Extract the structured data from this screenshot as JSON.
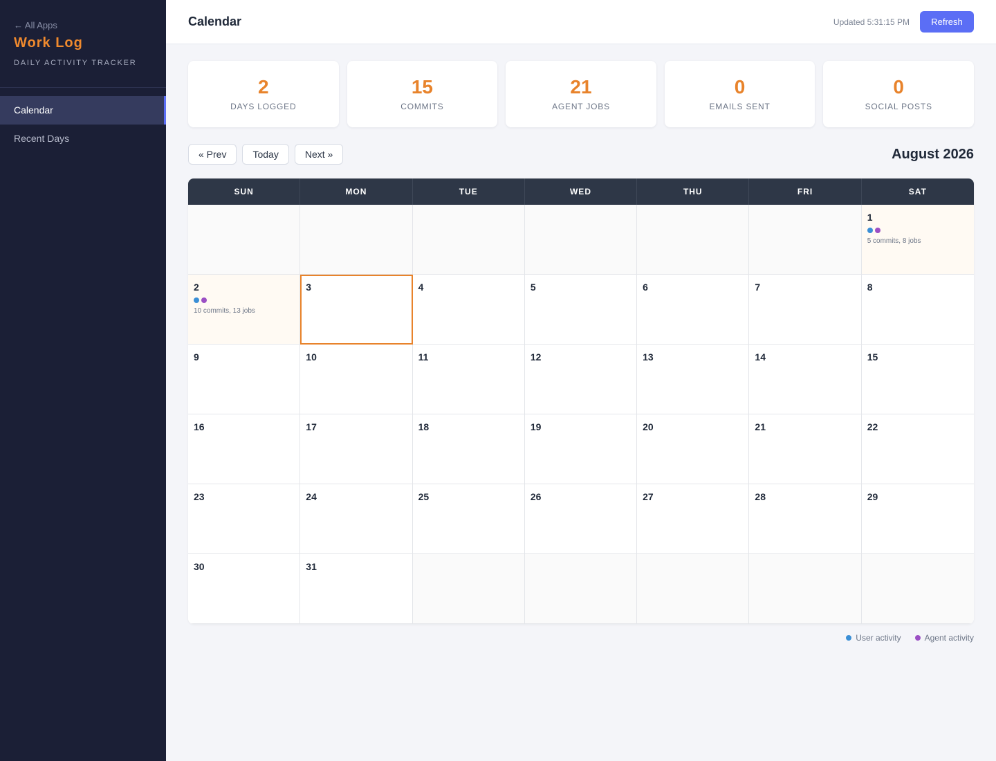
{
  "sidebar": {
    "back_label": "← All Apps",
    "app_title": "Work Log",
    "app_subtitle": "DAILY ACTIVITY TRACKER",
    "items": [
      {
        "label": "Calendar",
        "active": true
      },
      {
        "label": "Recent Days",
        "active": false
      }
    ]
  },
  "header": {
    "title": "Calendar",
    "updated": "Updated 5:31:15 PM",
    "refresh_label": "Refresh"
  },
  "stats": [
    {
      "value": "2",
      "label": "DAYS LOGGED"
    },
    {
      "value": "15",
      "label": "COMMITS"
    },
    {
      "value": "21",
      "label": "AGENT JOBS"
    },
    {
      "value": "0",
      "label": "EMAILS SENT"
    },
    {
      "value": "0",
      "label": "SOCIAL POSTS"
    }
  ],
  "calendar_nav": {
    "prev_label": "« Prev",
    "today_label": "Today",
    "next_label": "Next »",
    "month_title": "August 2026"
  },
  "calendar": {
    "weekdays": [
      "SUN",
      "MON",
      "TUE",
      "WED",
      "THU",
      "FRI",
      "SAT"
    ],
    "weeks": [
      [
        null,
        null,
        null,
        null,
        null,
        null,
        {
          "day": "1",
          "summary": "5 commits, 8 jobs",
          "user": true,
          "agent": true
        }
      ],
      [
        {
          "day": "2",
          "summary": "10 commits, 13 jobs",
          "user": true,
          "agent": true
        },
        {
          "day": "3",
          "today": true
        },
        {
          "day": "4"
        },
        {
          "day": "5"
        },
        {
          "day": "6"
        },
        {
          "day": "7"
        },
        {
          "day": "8"
        }
      ],
      [
        {
          "day": "9"
        },
        {
          "day": "10"
        },
        {
          "day": "11"
        },
        {
          "day": "12"
        },
        {
          "day": "13"
        },
        {
          "day": "14"
        },
        {
          "day": "15"
        }
      ],
      [
        {
          "day": "16"
        },
        {
          "day": "17"
        },
        {
          "day": "18"
        },
        {
          "day": "19"
        },
        {
          "day": "20"
        },
        {
          "day": "21"
        },
        {
          "day": "22"
        }
      ],
      [
        {
          "day": "23"
        },
        {
          "day": "24"
        },
        {
          "day": "25"
        },
        {
          "day": "26"
        },
        {
          "day": "27"
        },
        {
          "day": "28"
        },
        {
          "day": "29"
        }
      ],
      [
        {
          "day": "30"
        },
        {
          "day": "31"
        },
        null,
        null,
        null,
        null,
        null
      ]
    ]
  },
  "legend": {
    "user_label": "User activity",
    "agent_label": "Agent activity"
  },
  "colors": {
    "accent": "#e8832b",
    "primary": "#5b6ef5",
    "user_dot": "#3a8fd6",
    "agent_dot": "#9b4fc4",
    "sidebar_bg": "#1b1f36"
  }
}
